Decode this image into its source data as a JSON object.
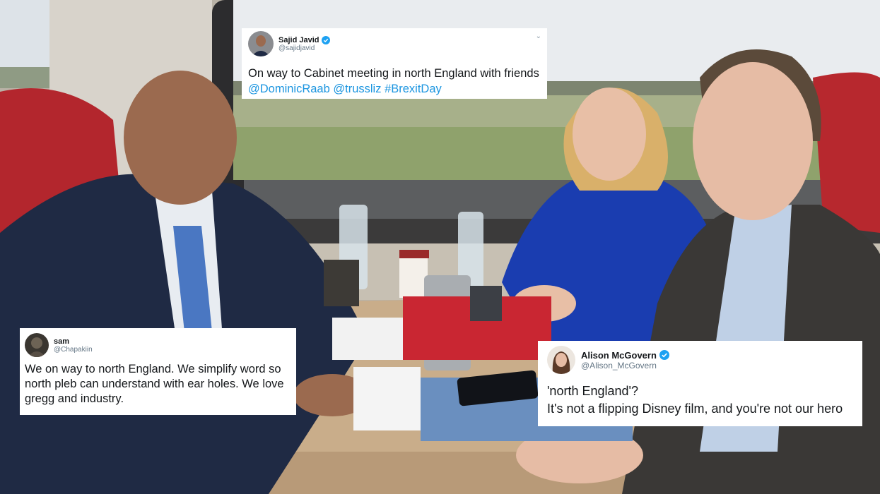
{
  "tweets": [
    {
      "name": "Sajid Javid",
      "handle": "@sajidjavid",
      "verified": true,
      "text": "On way to Cabinet meeting in north England with friends",
      "links": [
        "@DominicRaab",
        "@trussliz",
        "#BrexitDay"
      ]
    },
    {
      "name": "sam",
      "handle": "@Chapakiin",
      "verified": false,
      "text": "We on way to north England. We simplify word so north pleb can understand with ear holes. We love gregg and industry."
    },
    {
      "name": "Alison McGovern",
      "handle": "@Alison_McGovern",
      "verified": true,
      "text_line1": "'north England'?",
      "text_line2": "It's not a flipping Disney film, and you're not our hero"
    }
  ],
  "colors": {
    "link": "#1b95e0",
    "verified": "#1da1f2",
    "handle": "#657786"
  }
}
